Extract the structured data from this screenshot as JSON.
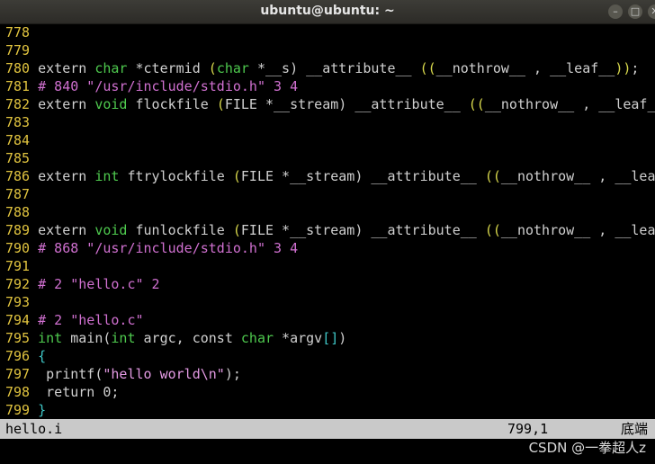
{
  "window": {
    "title": "ubuntu@ubuntu: ~"
  },
  "lines": [
    {
      "n": "778",
      "segs": []
    },
    {
      "n": "779",
      "segs": []
    },
    {
      "n": "780",
      "segs": [
        [
          "t",
          "extern "
        ],
        [
          "type",
          "char"
        ],
        [
          "t",
          " *ctermid "
        ],
        [
          "kw",
          "("
        ],
        [
          "type",
          "char"
        ],
        [
          "t",
          " *__s) __attribute__ "
        ],
        [
          "kw",
          "(("
        ],
        [
          "t",
          "__nothrow__ , __leaf__"
        ],
        [
          "kw",
          "))"
        ],
        [
          "t",
          ";"
        ]
      ]
    },
    {
      "n": "781",
      "segs": [
        [
          "pp",
          "# 840 \"/usr/include/stdio.h\" 3 4"
        ]
      ]
    },
    {
      "n": "782",
      "segs": [
        [
          "t",
          "extern "
        ],
        [
          "type",
          "void"
        ],
        [
          "t",
          " flockfile "
        ],
        [
          "kw",
          "("
        ],
        [
          "t",
          "FILE *__stream) __attribute__ "
        ],
        [
          "kw",
          "(("
        ],
        [
          "t",
          "__nothrow__ , __leaf_"
        ]
      ]
    },
    {
      "n": "783",
      "segs": []
    },
    {
      "n": "784",
      "segs": []
    },
    {
      "n": "785",
      "segs": []
    },
    {
      "n": "786",
      "segs": [
        [
          "t",
          "extern "
        ],
        [
          "type",
          "int"
        ],
        [
          "t",
          " ftrylockfile "
        ],
        [
          "kw",
          "("
        ],
        [
          "t",
          "FILE *__stream) __attribute__ "
        ],
        [
          "kw",
          "(("
        ],
        [
          "t",
          "__nothrow__ , __lea"
        ]
      ]
    },
    {
      "n": "787",
      "segs": []
    },
    {
      "n": "788",
      "segs": []
    },
    {
      "n": "789",
      "segs": [
        [
          "t",
          "extern "
        ],
        [
          "type",
          "void"
        ],
        [
          "t",
          " funlockfile "
        ],
        [
          "kw",
          "("
        ],
        [
          "t",
          "FILE *__stream) __attribute__ "
        ],
        [
          "kw",
          "(("
        ],
        [
          "t",
          "__nothrow__ , __lea"
        ]
      ]
    },
    {
      "n": "790",
      "segs": [
        [
          "pp",
          "# 868 \"/usr/include/stdio.h\" 3 4"
        ]
      ]
    },
    {
      "n": "791",
      "segs": []
    },
    {
      "n": "792",
      "segs": [
        [
          "pp",
          "# 2 \"hello.c\" 2"
        ]
      ]
    },
    {
      "n": "793",
      "segs": []
    },
    {
      "n": "794",
      "segs": [
        [
          "pp",
          "# 2 \"hello.c\""
        ]
      ]
    },
    {
      "n": "795",
      "segs": [
        [
          "type",
          "int"
        ],
        [
          "t",
          " main("
        ],
        [
          "type",
          "int"
        ],
        [
          "t",
          " argc, const "
        ],
        [
          "type",
          "char"
        ],
        [
          "t",
          " *argv"
        ],
        [
          "br",
          "[]"
        ],
        [
          "t",
          ")"
        ]
      ]
    },
    {
      "n": "796",
      "segs": [
        [
          "br",
          "{"
        ]
      ]
    },
    {
      "n": "797",
      "segs": [
        [
          "t",
          " printf("
        ],
        [
          "str",
          "\"hello world\\n\""
        ],
        [
          "t",
          ");"
        ]
      ]
    },
    {
      "n": "798",
      "segs": [
        [
          "t",
          " return 0;"
        ]
      ]
    },
    {
      "n": "799",
      "segs": [
        [
          "br",
          "}"
        ]
      ]
    }
  ],
  "status": {
    "filename": "hello.i",
    "position": "799,1",
    "scroll": "底端"
  },
  "watermark": "CSDN @一拳超人z"
}
